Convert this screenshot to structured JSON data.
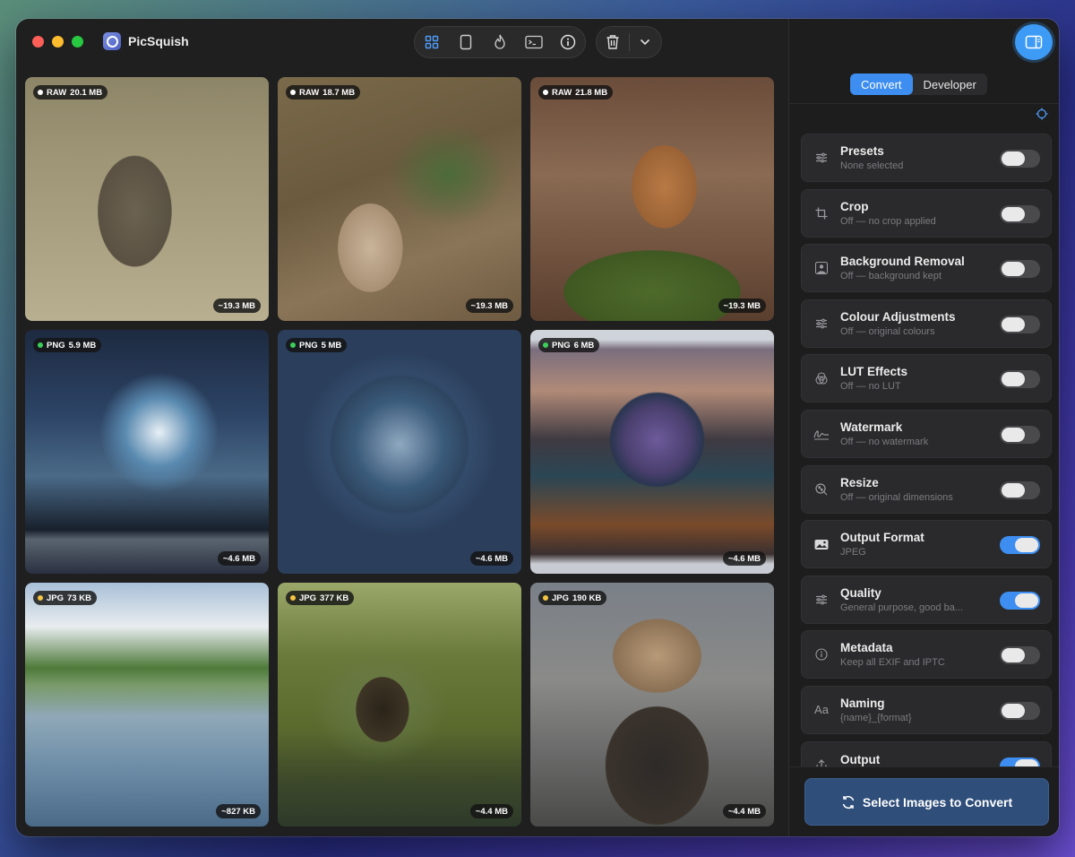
{
  "app": {
    "name": "PicSquish"
  },
  "tabs": [
    {
      "label": "Convert",
      "active": true
    },
    {
      "label": "Developer",
      "active": false
    }
  ],
  "images": [
    {
      "format": "RAW",
      "size": "20.1 MB",
      "estimate": "~19.3 MB",
      "dot": "#ffffff",
      "scene": "lynx"
    },
    {
      "format": "RAW",
      "size": "18.7 MB",
      "estimate": "~19.3 MB",
      "dot": "#ffffff",
      "scene": "deer"
    },
    {
      "format": "RAW",
      "size": "21.8 MB",
      "estimate": "~19.3 MB",
      "dot": "#ffffff",
      "scene": "squirrel"
    },
    {
      "format": "PNG",
      "size": "5.9 MB",
      "estimate": "~4.6 MB",
      "dot": "#3ecf5a",
      "scene": "laptop-wave"
    },
    {
      "format": "PNG",
      "size": "5 MB",
      "estimate": "~4.6 MB",
      "dot": "#3ecf5a",
      "scene": "app-icon"
    },
    {
      "format": "PNG",
      "size": "6 MB",
      "estimate": "~4.6 MB",
      "dot": "#3ecf5a",
      "scene": "laptop-gauge"
    },
    {
      "format": "JPG",
      "size": "73 KB",
      "estimate": "~827 KB",
      "dot": "#f5c542",
      "scene": "lake"
    },
    {
      "format": "JPG",
      "size": "377 KB",
      "estimate": "~4.4 MB",
      "dot": "#f5c542",
      "scene": "hobbit-hole"
    },
    {
      "format": "JPG",
      "size": "190 KB",
      "estimate": "~4.4 MB",
      "dot": "#f5c542",
      "scene": "mouse"
    }
  ],
  "settings": [
    {
      "title": "Presets",
      "subtitle": "None selected",
      "on": false,
      "icon": "sliders-icon"
    },
    {
      "title": "Crop",
      "subtitle": "Off — no crop applied",
      "on": false,
      "icon": "crop-icon"
    },
    {
      "title": "Background Removal",
      "subtitle": "Off — background kept",
      "on": false,
      "icon": "person-icon"
    },
    {
      "title": "Colour Adjustments",
      "subtitle": "Off — original colours",
      "on": false,
      "icon": "sliders-icon"
    },
    {
      "title": "LUT Effects",
      "subtitle": "Off — no LUT",
      "on": false,
      "icon": "lut-icon"
    },
    {
      "title": "Watermark",
      "subtitle": "Off — no watermark",
      "on": false,
      "icon": "signature-icon"
    },
    {
      "title": "Resize",
      "subtitle": "Off — original dimensions",
      "on": false,
      "icon": "resize-icon"
    },
    {
      "title": "Output Format",
      "subtitle": "JPEG",
      "on": true,
      "icon": "photo-icon"
    },
    {
      "title": "Quality",
      "subtitle": "General purpose, good ba...",
      "on": true,
      "icon": "sliders-icon"
    },
    {
      "title": "Metadata",
      "subtitle": "Keep all EXIF and IPTC",
      "on": false,
      "icon": "info-icon"
    },
    {
      "title": "Naming",
      "subtitle": "{name}_{format}",
      "on": false,
      "icon": "text-icon"
    },
    {
      "title": "Output",
      "subtitle": "",
      "on": true,
      "icon": "share-icon"
    }
  ],
  "cta": {
    "label": "Select Images to Convert"
  },
  "colors": {
    "accent": "#3d8ef0",
    "png_dot": "#3ecf5a",
    "jpg_dot": "#f5c542"
  }
}
